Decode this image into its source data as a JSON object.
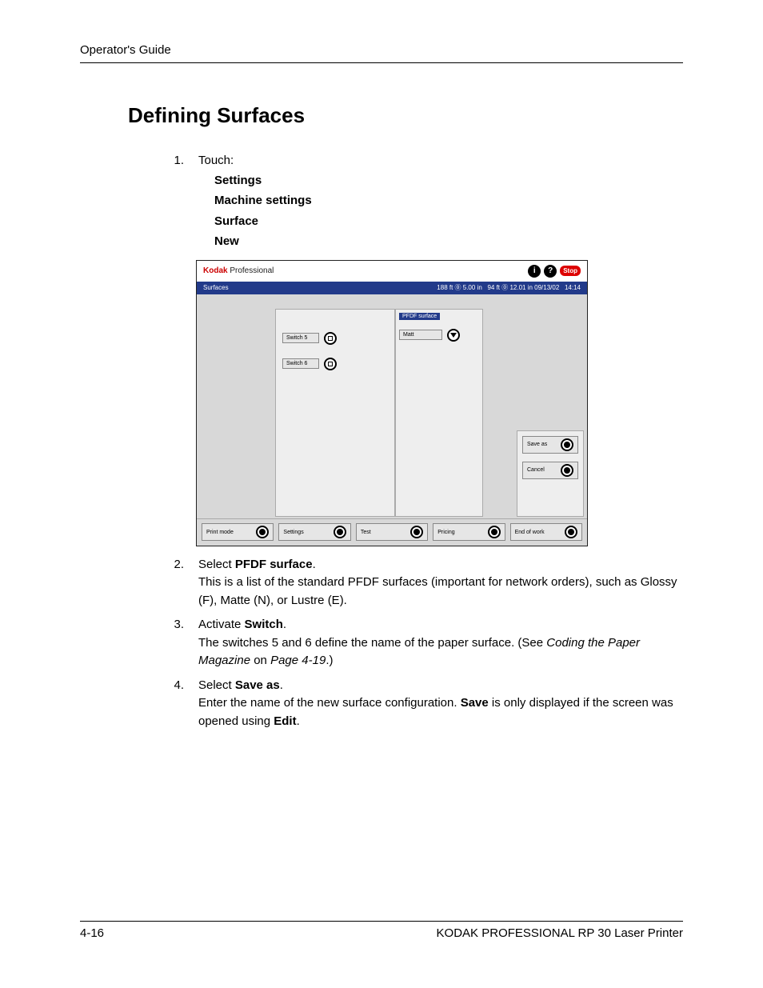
{
  "header": "Operator's Guide",
  "title": "Defining Surfaces",
  "steps": {
    "s1": {
      "num": "1.",
      "lead": "Touch:",
      "items": [
        "Settings",
        "Machine settings",
        "Surface",
        "New"
      ]
    },
    "s2": {
      "num": "2.",
      "line1a": "Select ",
      "line1b": "PFDF surface",
      "line1c": ".",
      "line2": "This is a list of the standard PFDF surfaces (important for network orders), such as Glossy (F), Matte (N), or Lustre (E)."
    },
    "s3": {
      "num": "3.",
      "line1a": "Activate ",
      "line1b": "Switch",
      "line1c": ".",
      "line2a": "The switches 5 and 6 define the name of the paper surface. (See ",
      "line2b": "Coding the Paper Magazine",
      "line2c": " on ",
      "line2d": "Page 4-19",
      "line2e": ".)"
    },
    "s4": {
      "num": "4.",
      "line1a": "Select ",
      "line1b": "Save as",
      "line1c": ".",
      "line2a": "Enter the name of the new surface configuration. ",
      "line2b": "Save",
      "line2c": " is only displayed if the screen was opened using ",
      "line2d": "Edit",
      "line2e": "."
    }
  },
  "screenshot": {
    "brand1": "Kodak",
    "brand2": " Professional",
    "icon_info": "i",
    "icon_help": "?",
    "stop": "Stop",
    "titlebar_left": "Surfaces",
    "status1": "188 ft ⓪ 5.00 in",
    "status2": "94 ft ⓪ 12.01 in 09/13/02",
    "time": "14:14",
    "switch5": "Switch 5",
    "switch6": "Switch 6",
    "pfdf_hdr": "PFDF surface",
    "pfdf_val": "Matt",
    "save_as": "Save as",
    "cancel": "Cancel",
    "footer_buttons": [
      "Print mode",
      "Settings",
      "Test",
      "Pricing",
      "End of work"
    ]
  },
  "footer": {
    "left": "4-16",
    "right": "KODAK PROFESSIONAL RP 30 Laser Printer"
  }
}
